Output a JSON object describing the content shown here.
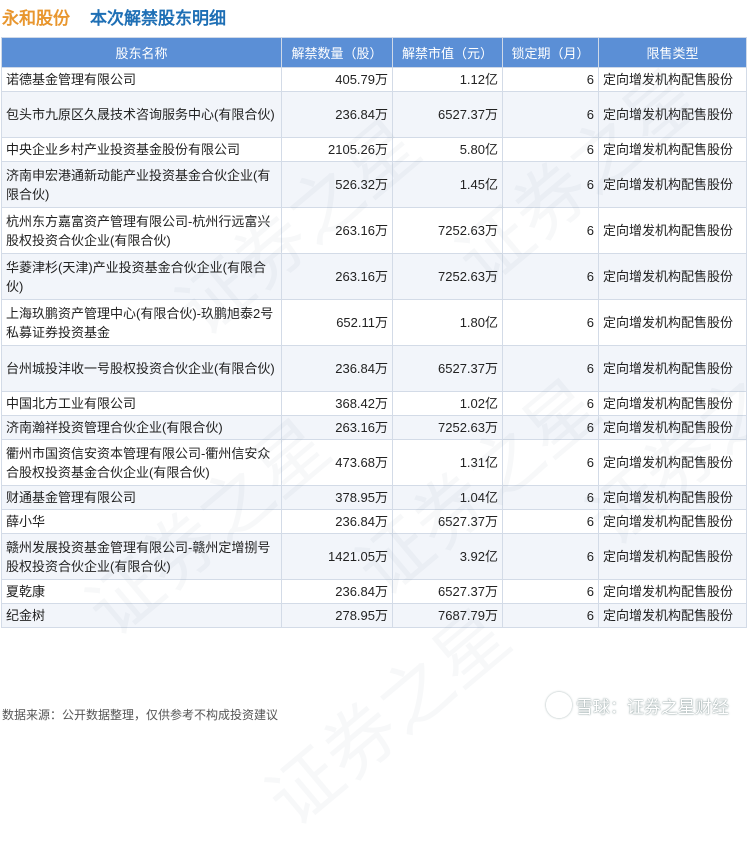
{
  "title": {
    "company": "永和股份",
    "subtitle": "本次解禁股东明细"
  },
  "table": {
    "headers": [
      "股东名称",
      "解禁数量（股）",
      "解禁市值（元）",
      "锁定期（月）",
      "限售类型"
    ],
    "rows": [
      {
        "name": "诺德基金管理有限公司",
        "qty": "405.79万",
        "value": "1.12亿",
        "lock": "6",
        "type": "定向增发机构配售股份"
      },
      {
        "name": "包头市九原区久晟技术咨询服务中心(有限合伙)",
        "qty": "236.84万",
        "value": "6527.37万",
        "lock": "6",
        "type": "定向增发机构配售股份"
      },
      {
        "name": "中央企业乡村产业投资基金股份有限公司",
        "qty": "2105.26万",
        "value": "5.80亿",
        "lock": "6",
        "type": "定向增发机构配售股份"
      },
      {
        "name": "济南申宏港通新动能产业投资基金合伙企业(有限合伙)",
        "qty": "526.32万",
        "value": "1.45亿",
        "lock": "6",
        "type": "定向增发机构配售股份"
      },
      {
        "name": "杭州东方嘉富资产管理有限公司-杭州行远富兴股权投资合伙企业(有限合伙)",
        "qty": "263.16万",
        "value": "7252.63万",
        "lock": "6",
        "type": "定向增发机构配售股份"
      },
      {
        "name": "华菱津杉(天津)产业投资基金合伙企业(有限合伙)",
        "qty": "263.16万",
        "value": "7252.63万",
        "lock": "6",
        "type": "定向增发机构配售股份"
      },
      {
        "name": "上海玖鹏资产管理中心(有限合伙)-玖鹏旭泰2号私募证券投资基金",
        "qty": "652.11万",
        "value": "1.80亿",
        "lock": "6",
        "type": "定向增发机构配售股份"
      },
      {
        "name": "台州城投沣收一号股权投资合伙企业(有限合伙)",
        "qty": "236.84万",
        "value": "6527.37万",
        "lock": "6",
        "type": "定向增发机构配售股份"
      },
      {
        "name": "中国北方工业有限公司",
        "qty": "368.42万",
        "value": "1.02亿",
        "lock": "6",
        "type": "定向增发机构配售股份"
      },
      {
        "name": "济南瀚祥投资管理合伙企业(有限合伙)",
        "qty": "263.16万",
        "value": "7252.63万",
        "lock": "6",
        "type": "定向增发机构配售股份"
      },
      {
        "name": "衢州市国资信安资本管理有限公司-衢州信安众合股权投资基金合伙企业(有限合伙)",
        "qty": "473.68万",
        "value": "1.31亿",
        "lock": "6",
        "type": "定向增发机构配售股份"
      },
      {
        "name": "财通基金管理有限公司",
        "qty": "378.95万",
        "value": "1.04亿",
        "lock": "6",
        "type": "定向增发机构配售股份"
      },
      {
        "name": "薛小华",
        "qty": "236.84万",
        "value": "6527.37万",
        "lock": "6",
        "type": "定向增发机构配售股份"
      },
      {
        "name": "赣州发展投资基金管理有限公司-赣州定增捌号股权投资合伙企业(有限合伙)",
        "qty": "1421.05万",
        "value": "3.92亿",
        "lock": "6",
        "type": "定向增发机构配售股份"
      },
      {
        "name": "夏乾康",
        "qty": "236.84万",
        "value": "6527.37万",
        "lock": "6",
        "type": "定向增发机构配售股份"
      },
      {
        "name": "纪金树",
        "qty": "278.95万",
        "value": "7687.79万",
        "lock": "6",
        "type": "定向增发机构配售股份"
      }
    ]
  },
  "footer": {
    "source": "数据来源：公开数据整理，仅供参考不构成投资建议",
    "brand": "雪球：证券之星财经"
  },
  "watermark_text": "证券之星"
}
